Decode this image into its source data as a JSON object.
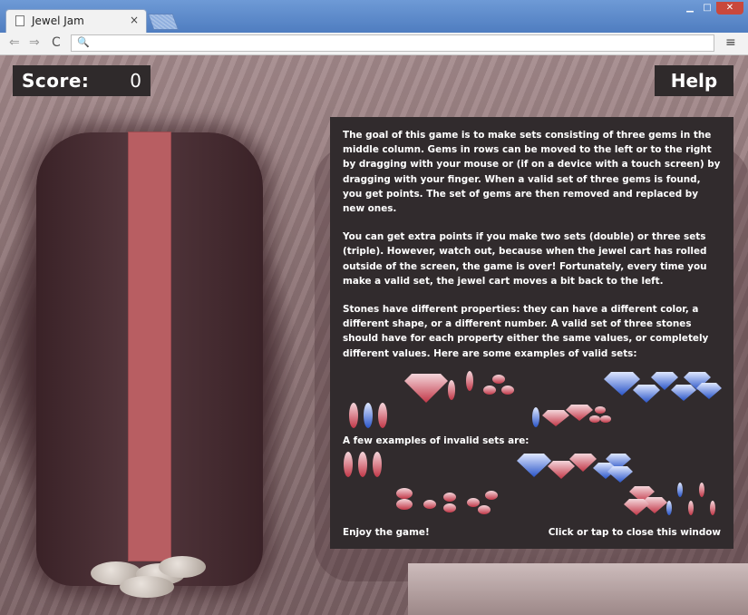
{
  "browser": {
    "tab_title": "Jewel Jam",
    "tab_close": "×",
    "window_controls": {
      "minimize": "▁",
      "maximize": "□",
      "close": "✕"
    },
    "nav": {
      "back": "⇐",
      "forward": "⇒",
      "reload": "C"
    },
    "omnibox_icon": "🔍",
    "address": "",
    "menu": "≡"
  },
  "game": {
    "score_label": "Score:",
    "score_value": "0",
    "help_label": "Help",
    "help": {
      "para1": "The goal of this game is to make sets consisting of three gems in the middle column. Gems in rows can be moved to the left or to the right by dragging with your mouse or (if on a device with a touch screen) by dragging with your finger. When a valid set of three gems is found, you get points. The set of gems are then removed and replaced by new ones.",
      "para2": "You can get extra points if you make two sets (double) or three sets (triple). However, watch out, because when the jewel cart has rolled outside of the screen, the game is over! Fortunately, every time you make a valid set, the jewel cart moves a bit back to the left.",
      "para3": "Stones have different properties: they can have a different color, a different shape, or a different number. A valid set of three stones should have for each property either the same values, or completely different values. Here are some examples of valid sets:",
      "invalid_intro": "A few examples of invalid sets are:",
      "enjoy": "Enjoy the game!",
      "close_hint": "Click or tap to close this window"
    },
    "colors": {
      "panel": "#312b2d",
      "column": "#b85e62",
      "red_gem": "#c8505a",
      "blue_gem": "#3a64c8",
      "white_gem": "#e8e0e8"
    }
  }
}
